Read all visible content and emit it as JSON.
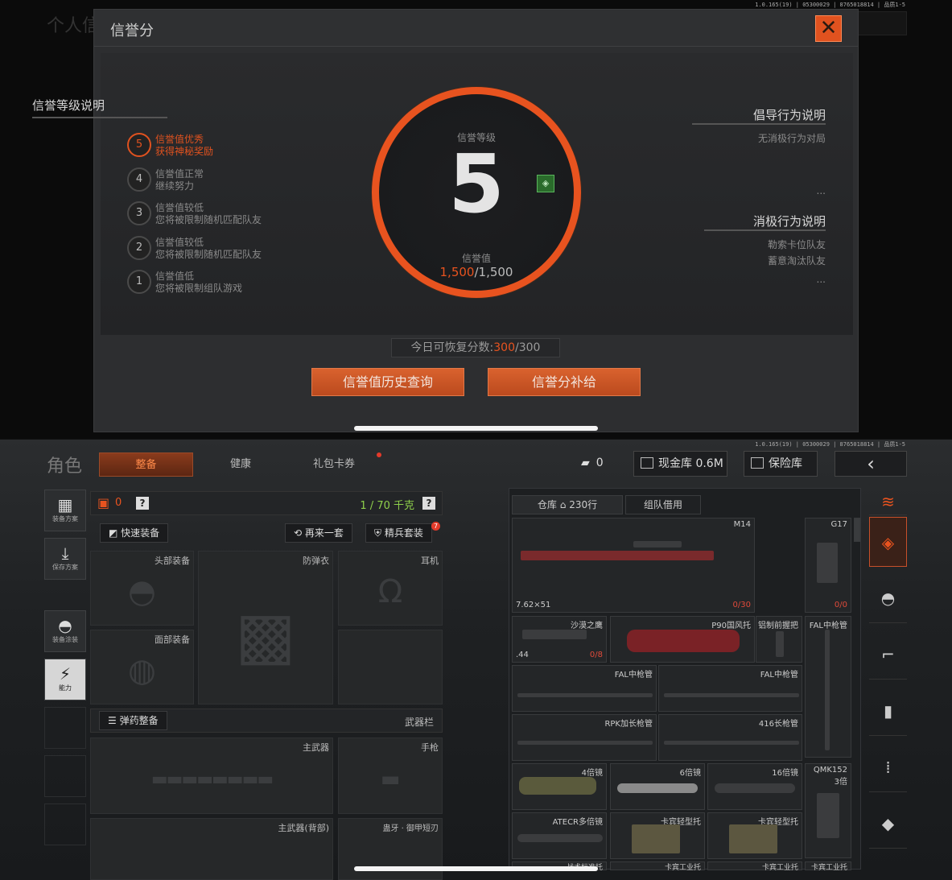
{
  "version": "1.0.165(19) | 05300029 | 8765018814 | 品质1-5",
  "top": {
    "bg_title": "个人信",
    "modal": {
      "title": "信誉分",
      "close_icon": "✕",
      "levels_title": "信誉等级说明",
      "levels": [
        {
          "num": "5",
          "line1": "信誉值优秀",
          "line2": "获得神秘奖励",
          "active": true
        },
        {
          "num": "4",
          "line1": "信誉值正常",
          "line2": "继续努力"
        },
        {
          "num": "3",
          "line1": "信誉值较低",
          "line2": "您将被限制随机匹配队友"
        },
        {
          "num": "2",
          "line1": "信誉值较低",
          "line2": "您将被限制随机匹配队友"
        },
        {
          "num": "1",
          "line1": "信誉值低",
          "line2": "您将被限制组队游戏"
        }
      ],
      "ring": {
        "level_label": "信誉等级",
        "level": "5",
        "score_label": "信誉值",
        "score_current": "1,500",
        "score_max": "/1,500",
        "accent": "#e8531f"
      },
      "positive": {
        "title": "倡导行为说明",
        "items": [
          "无消极行为对局",
          "..."
        ]
      },
      "negative": {
        "title": "消极行为说明",
        "items": [
          "勒索卡位队友",
          "蓄意淘汰队友",
          "..."
        ]
      },
      "recover": {
        "label": "今日可恢复分数:",
        "current": "300",
        "max": "/300"
      },
      "buttons": {
        "history": "信誉值历史查询",
        "refill": "信誉分补给"
      }
    }
  },
  "bottom": {
    "role_title": "角色",
    "tabs": [
      "整备",
      "健康",
      "礼包卡券"
    ],
    "chips": {
      "tickets": "0",
      "cash": "现金库 0.6M",
      "insurance": "保险库"
    },
    "side": [
      "装备方案",
      "保存方案",
      "装备涂装",
      "能力"
    ],
    "weight": {
      "armor_count": "0",
      "capacity": "1 / 70 千克"
    },
    "buttons": {
      "quick": "快速装备",
      "again": "再来一套",
      "elite": "精兵套装",
      "elite_badge": "7",
      "ammo": "弹药整备"
    },
    "slots": {
      "head": "头部装备",
      "vest": "防弹衣",
      "ear": "耳机",
      "face": "面部装备",
      "weapons_bar": "武器栏",
      "main": "主武器",
      "pistol": "手枪",
      "main_back": "主武器(背部)",
      "melee": "蛊牙 · 御甲短刃"
    },
    "inventory": {
      "tab_warehouse": "仓库",
      "warehouse_count": "230行",
      "tab_team": "组队借用",
      "items": {
        "m14": "M14",
        "m14_ammo": "7.62×51",
        "m14_count": "0/30",
        "g17": "G17",
        "g17_count": "0/0",
        "desert": "沙漠之鹰",
        "desert_ammo": ".44",
        "desert_count": "0/8",
        "p90": "P90国风托",
        "grip": "铝制前握把",
        "fal_tube": "FAL中枪管",
        "fal1": "FAL中枪管",
        "fal2": "FAL中枪管",
        "rpk": "RPK加长枪管",
        "416": "416长枪管",
        "scope4": "4倍镜",
        "scope6": "6倍镜",
        "scope16": "16倍镜",
        "qmk": "QMK152",
        "qmk_sub": "3倍",
        "atecr": "ATECR多倍镜",
        "stock1": "卡宾轻型托",
        "stock2": "卡宾轻型托",
        "row_bottom1": "战术标准托",
        "row_bottom2": "卡宾工业托",
        "row_bottom3": "卡宾工业托",
        "row_bottom4": "卡宾工业托"
      }
    }
  }
}
